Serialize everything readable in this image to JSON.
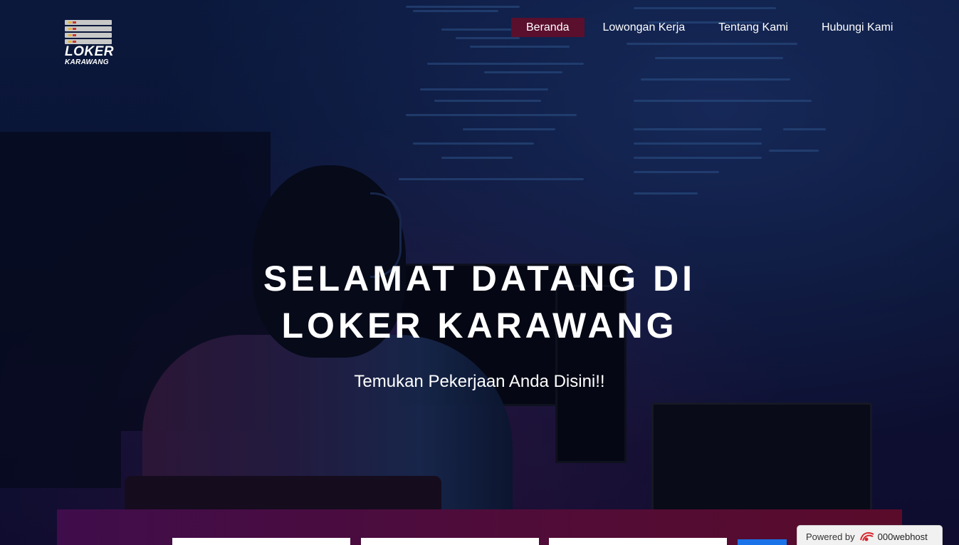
{
  "brand": {
    "logo_main": "LOKER",
    "logo_sub": "KARAWANG"
  },
  "nav": {
    "items": [
      {
        "label": "Beranda",
        "active": true
      },
      {
        "label": "Lowongan Kerja",
        "active": false
      },
      {
        "label": "Tentang Kami",
        "active": false
      },
      {
        "label": "Hubungi Kami",
        "active": false
      }
    ]
  },
  "hero": {
    "title_line1": "SELAMAT DATANG DI",
    "title_line2": "LOKER KARAWANG",
    "subtitle": "Temukan Pekerjaan Anda Disini!!"
  },
  "powered": {
    "label": "Powered by",
    "brand": "000webhost"
  },
  "colors": {
    "nav_active": "#5a0f2c",
    "search_band_start": "#3f0d4b",
    "search_band_end": "#5a0b2a",
    "search_button": "#1a73e8"
  }
}
